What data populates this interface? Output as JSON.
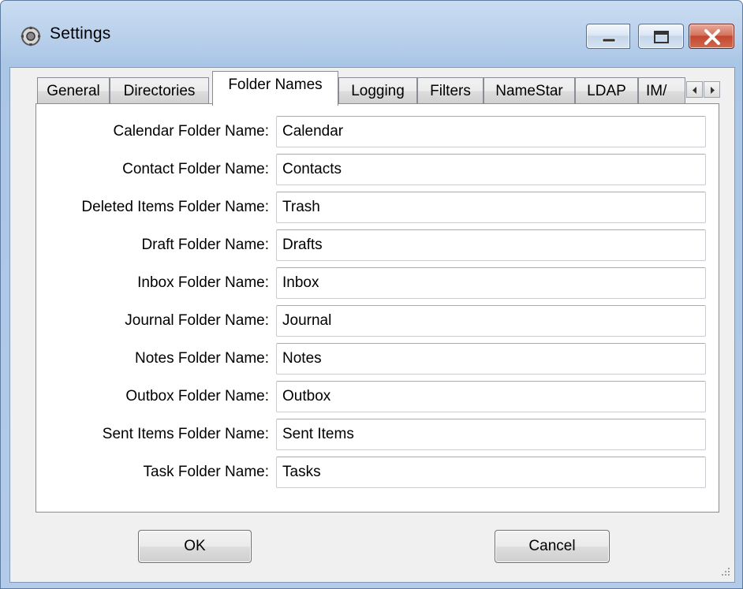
{
  "window": {
    "title": "Settings",
    "app_icon": "settings-gear-icon",
    "controls": [
      "minimize-icon",
      "maximize-icon",
      "close-icon"
    ]
  },
  "tabs": [
    {
      "label": "General",
      "active": false
    },
    {
      "label": "Directories",
      "active": false
    },
    {
      "label": "Folder Names",
      "active": true
    },
    {
      "label": "Logging",
      "active": false
    },
    {
      "label": "Filters",
      "active": false
    },
    {
      "label": "NameStar",
      "active": false
    },
    {
      "label": "LDAP",
      "active": false
    },
    {
      "label": "IM/",
      "active": false
    }
  ],
  "tab_scroll": {
    "left_icon": "scroll-left-icon",
    "right_icon": "scroll-right-icon"
  },
  "fields": [
    {
      "label": "Calendar Folder Name:",
      "value": "Calendar"
    },
    {
      "label": "Contact Folder Name:",
      "value": "Contacts"
    },
    {
      "label": "Deleted Items Folder Name:",
      "value": "Trash"
    },
    {
      "label": "Draft Folder Name:",
      "value": "Drafts"
    },
    {
      "label": "Inbox Folder Name:",
      "value": "Inbox"
    },
    {
      "label": "Journal Folder Name:",
      "value": "Journal"
    },
    {
      "label": "Notes Folder Name:",
      "value": "Notes"
    },
    {
      "label": "Outbox Folder Name:",
      "value": "Outbox"
    },
    {
      "label": "Sent Items Folder Name:",
      "value": "Sent Items"
    },
    {
      "label": "Task Folder Name:",
      "value": "Tasks"
    }
  ],
  "buttons": {
    "ok": "OK",
    "cancel": "Cancel"
  },
  "colors": {
    "close_button": "#c2472f",
    "title_bar": "#bcd2ec",
    "panel": "#ffffff"
  }
}
